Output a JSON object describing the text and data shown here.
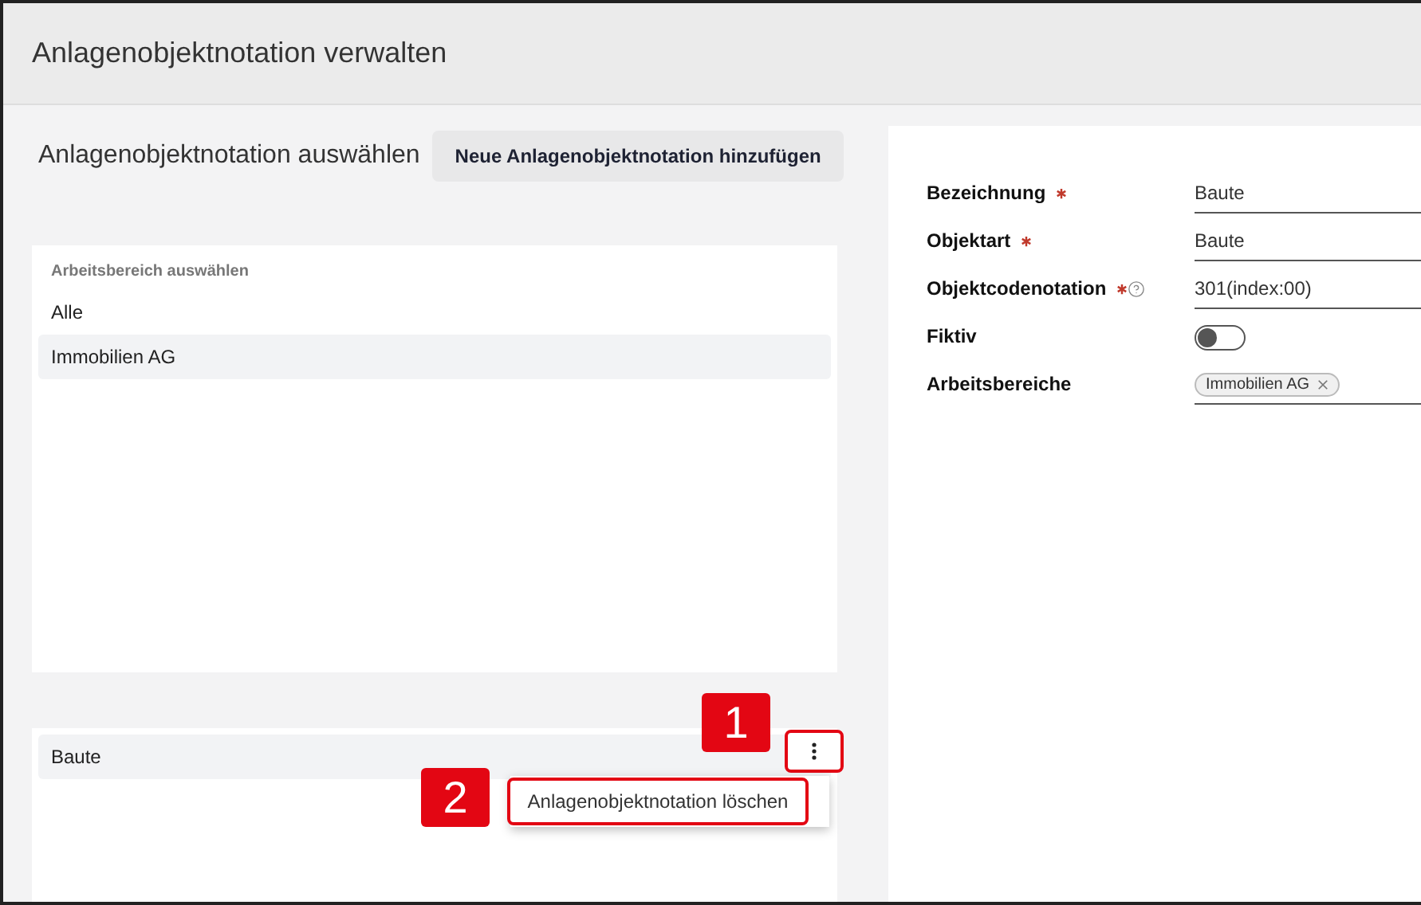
{
  "header": {
    "title": "Anlagenobjektnotation verwalten"
  },
  "section": {
    "title": "Anlagenobjektnotation auswählen",
    "add_button": "Neue Anlagenobjektnotation hinzufügen"
  },
  "workspace_list": {
    "label": "Arbeitsbereich auswählen",
    "items": [
      {
        "label": "Alle",
        "selected": false
      },
      {
        "label": "Immobilien AG",
        "selected": true
      }
    ]
  },
  "notation_list": {
    "items": [
      {
        "label": "Baute",
        "selected": true
      }
    ],
    "menu_button": {
      "highlighted": true
    },
    "menu": {
      "open": true,
      "items": [
        {
          "label": "Anlagenobjektnotation löschen",
          "highlighted": true
        }
      ]
    }
  },
  "form": {
    "fields": [
      {
        "kind": "text",
        "label": "Bezeichnung",
        "required": true,
        "help": false,
        "value": "Baute"
      },
      {
        "kind": "text",
        "label": "Objektart",
        "required": true,
        "help": false,
        "value": "Baute"
      },
      {
        "kind": "text",
        "label": "Objektcodenotation",
        "required": true,
        "help": true,
        "value": "301(index:00)"
      },
      {
        "kind": "toggle",
        "label": "Fiktiv",
        "required": false,
        "help": false,
        "on": false
      },
      {
        "kind": "tags",
        "label": "Arbeitsbereiche",
        "required": false,
        "help": false,
        "tags": [
          "Immobilien AG"
        ]
      }
    ]
  },
  "callouts": [
    {
      "number": "1"
    },
    {
      "number": "2"
    }
  ]
}
